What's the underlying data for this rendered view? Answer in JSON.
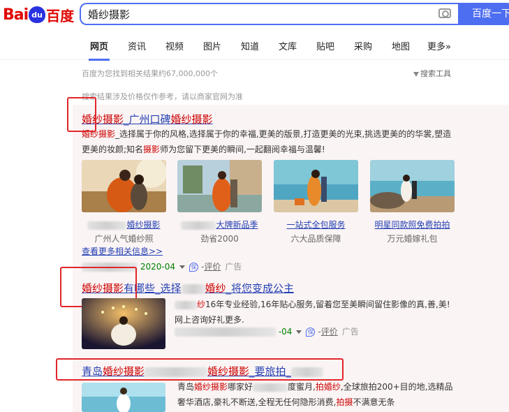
{
  "logo": {
    "latin": "Bai",
    "paw": "du",
    "cn": "百度"
  },
  "search": {
    "value": "婚纱摄影",
    "button": "百度一下"
  },
  "tabs": [
    "网页",
    "资讯",
    "视频",
    "图片",
    "知道",
    "文库",
    "贴吧",
    "采购",
    "地图",
    "更多»"
  ],
  "result_info": "百度为您找到相关结果约67,000,000个",
  "search_tools": "搜索工具",
  "disclaimer": "搜索结果涉及价格仅作参考，请以商家官网为准",
  "result1": {
    "title_em1": "婚纱摄影",
    "title_mid": "_广州口碑",
    "title_em2": "婚纱摄影",
    "desc_em1": "婚纱摄影",
    "desc_part1": "_选择属于你的风格,选择属于你的幸福,更美的版景,打造更美的光束,挑选更美的的华裳,塑造更美的妆颜;知名",
    "desc_em2": "摄影",
    "desc_part2": "师为您留下更美的瞬间,一起翻阅幸福与温馨!",
    "thumbs": [
      {
        "title": "婚纱摄影",
        "sub": "广州人气婚纱照"
      },
      {
        "title": "大牌新品季",
        "sub": "劲省2000"
      },
      {
        "title": "一站式全包服务",
        "sub": "六大品质保障"
      },
      {
        "title": "明星同款照免费拍拍",
        "sub": "万元婚嫁礼包"
      }
    ],
    "more_link": "查看更多相关信息>>",
    "date": "2020-04",
    "eval": "评价",
    "ad": "广告"
  },
  "result2": {
    "title_em1": "婚纱摄影",
    "title_mid1": "有哪些_选择",
    "title_em2": "婚纱",
    "title_mid2": "_将您变成公主",
    "desc_em": "纱",
    "desc": "16年专业经验,16年贴心服务,留着您至美瞬间留住影像的真,善,美!网上咨询好礼更多.",
    "date": "-04",
    "eval": "评价",
    "ad": "广告"
  },
  "result3": {
    "title_pre": "青岛",
    "title_em1": "婚纱摄影",
    "title_em2": "婚纱摄影",
    "title_mid": "_要旅拍_",
    "desc_pre": "青岛",
    "desc_em1": "婚纱摄影",
    "desc_mid1": "哪家好",
    "desc_mid2": "度蜜月,",
    "desc_em2": "拍婚纱",
    "desc_mid3": ",全球旅拍200+目的地,选精品奢华酒店,豪礼不断送,全程无任何隐形消费,",
    "desc_em3": "拍摄",
    "desc_end": "不满意无条"
  },
  "colors": {
    "accent": "#4e6ef2",
    "brand_red": "#e10601",
    "highlight": "#c00",
    "link": "#2440b3",
    "annotation": "#e0262a"
  }
}
